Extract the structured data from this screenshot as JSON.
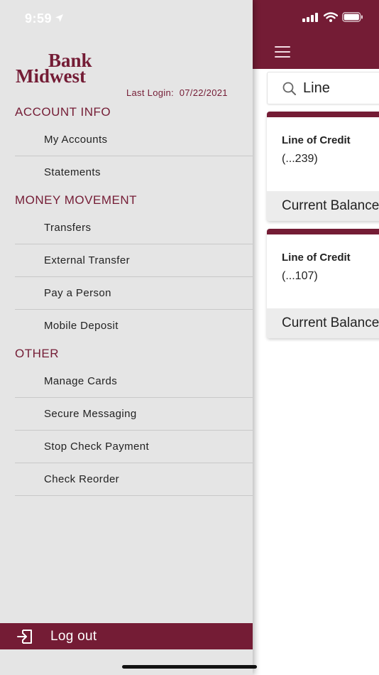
{
  "status_bar": {
    "time": "9:59"
  },
  "drawer": {
    "brand_line1": "Bank",
    "brand_line2": "Midwest",
    "last_login_label": "Last Login:",
    "last_login_date": "07/22/2021",
    "sections": [
      {
        "title": "ACCOUNT INFO",
        "items": [
          "My Accounts",
          "Statements"
        ]
      },
      {
        "title": "MONEY MOVEMENT",
        "items": [
          "Transfers",
          "External Transfer",
          "Pay a Person",
          "Mobile Deposit"
        ]
      },
      {
        "title": "OTHER",
        "items": [
          "Manage Cards",
          "Secure Messaging",
          "Stop Check Payment",
          "Check Reorder"
        ]
      }
    ],
    "logout_label": "Log out"
  },
  "main": {
    "search_value": "Line",
    "cards": [
      {
        "title": "Line of Credit",
        "number": "(...239)",
        "balance_label": "Current Balance"
      },
      {
        "title": "Line of Credit",
        "number": "(...107)",
        "balance_label": "Current Balance"
      }
    ]
  },
  "colors": {
    "brand": "#741c35",
    "drawer_bg": "#e5e5e5",
    "card_footer": "#ececec"
  },
  "icons": [
    "signal-icon",
    "wifi-icon",
    "battery-icon",
    "location-arrow-icon",
    "menu-icon",
    "search-icon",
    "logout-icon"
  ]
}
